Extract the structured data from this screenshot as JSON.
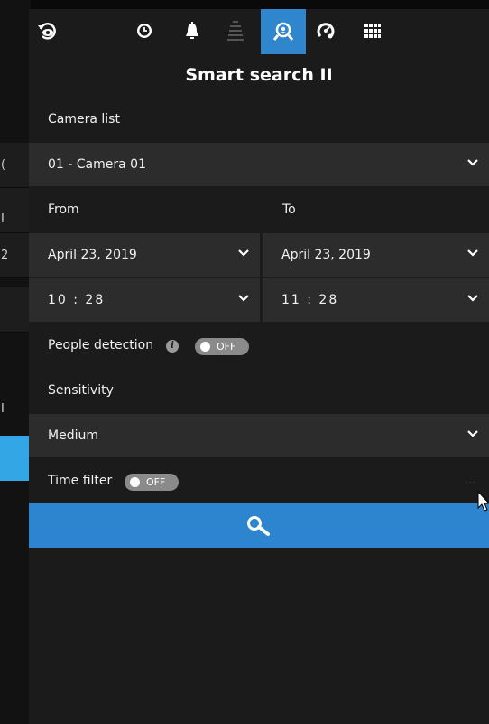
{
  "toolbar": {
    "icons": [
      "rotate-eye-icon",
      "clock-icon",
      "bell-icon",
      "lightning-icon",
      "smart-search-icon",
      "speedometer-icon",
      "grid-icon"
    ],
    "active_icon": "smart-search-icon"
  },
  "title": "Smart search II",
  "camera_list": {
    "label": "Camera list",
    "value": "01 - Camera 01"
  },
  "from": {
    "label": "From",
    "date": "April 23, 2019",
    "time": "10 : 28"
  },
  "to": {
    "label": "To",
    "date": "April 23, 2019",
    "time": "11 : 28"
  },
  "people_detection": {
    "label": "People detection",
    "toggle": "OFF"
  },
  "sensitivity": {
    "label": "Sensitivity",
    "value": "Medium"
  },
  "time_filter": {
    "label": "Time filter",
    "toggle": "OFF",
    "more": "···"
  },
  "background_fragments": [
    "(",
    "I",
    "2",
    "I"
  ],
  "colors": {
    "accent": "#2d84cf",
    "panel": "#1b1b1b",
    "field": "#2c2c2c",
    "toggle_off": "#8a8a8a"
  }
}
